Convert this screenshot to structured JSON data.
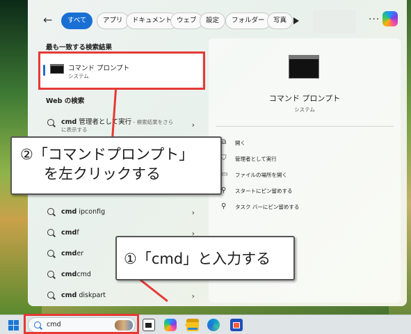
{
  "filter_bar": {
    "back_icon": "arrow-left-icon",
    "chips": [
      "すべて",
      "アプリ",
      "ドキュメント",
      "ウェブ",
      "設定",
      "フォルダー",
      "写真"
    ],
    "active_chip": "すべて",
    "more_icon": "play-icon"
  },
  "best_match": {
    "heading": "最も一致する検索結果",
    "title": "コマンド プロンプト",
    "subtitle": "システム"
  },
  "web_search": {
    "heading": "Web の検索",
    "first": {
      "query_bold": "cmd",
      "query_rest": " 管理者として実行",
      "hint_line1": " - 検索結果をさら",
      "hint_line2": "に表示する"
    },
    "items": [
      {
        "bold": "cmd",
        "rest": " ipconfig"
      },
      {
        "bold": "cmd",
        "rest": "f"
      },
      {
        "bold": "cmd",
        "rest": "er"
      },
      {
        "bold": "cmd",
        "rest": "cmd"
      },
      {
        "bold": "cmd",
        "rest": " diskpart"
      }
    ]
  },
  "detail_pane": {
    "title": "コマンド プロンプト",
    "subtitle": "システム",
    "actions": [
      {
        "icon": "open-icon",
        "label": "開く"
      },
      {
        "icon": "shield-icon",
        "label": "管理者として実行"
      },
      {
        "icon": "folder-icon",
        "label": "ファイルの場所を開く"
      },
      {
        "icon": "pin-icon",
        "label": "スタートにピン留めする"
      },
      {
        "icon": "pin-icon",
        "label": "タスク バーにピン留めする"
      }
    ]
  },
  "taskbar": {
    "search_value": "cmd",
    "apps": [
      "start-icon",
      "task-view-icon",
      "copilot-icon",
      "photos-icon",
      "file-explorer-icon",
      "edge-icon",
      "store-icon"
    ]
  },
  "annotations": {
    "step2_line1": "②「コマンドプロンプト」",
    "step2_line2": "を左クリックする",
    "step1": "①「cmd」と入力する",
    "color": "#e53935"
  }
}
